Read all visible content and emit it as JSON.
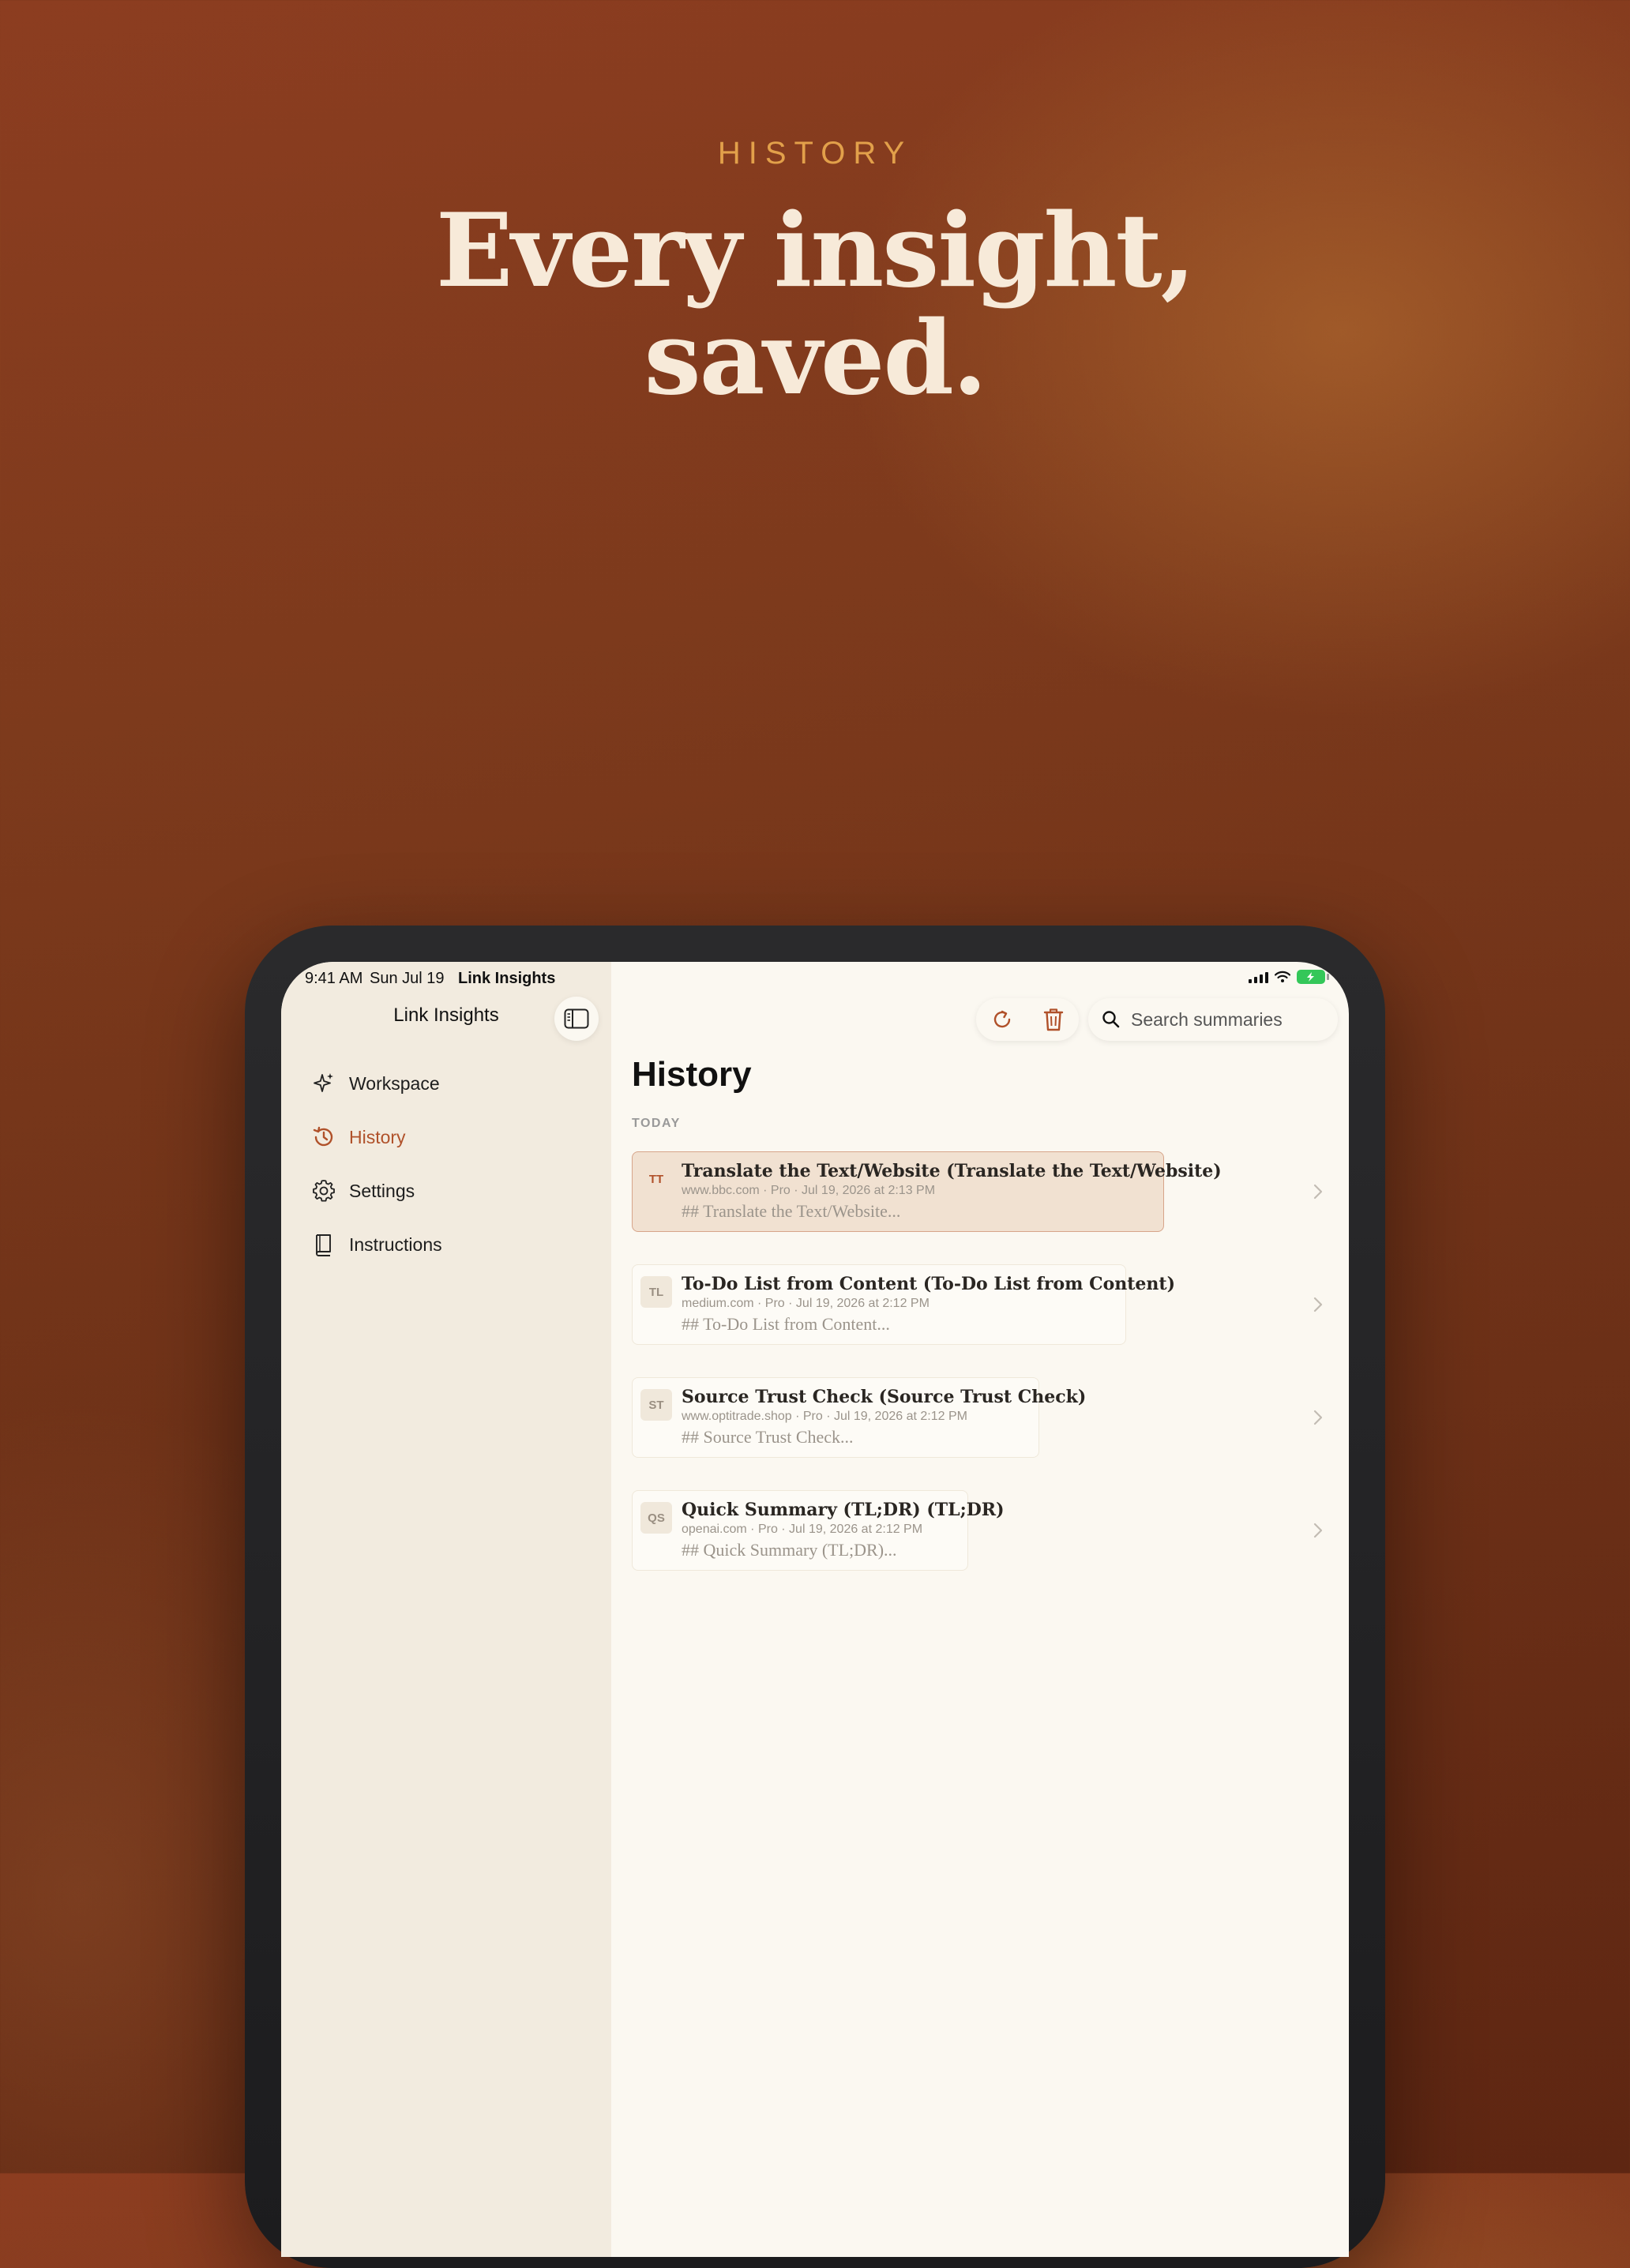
{
  "hero": {
    "kicker": "HISTORY",
    "headline_line1": "Every insight,",
    "headline_line2": "saved."
  },
  "status_bar": {
    "time": "9:41 AM",
    "date": "Sun Jul 19",
    "app_name": "Link Insights"
  },
  "sidebar": {
    "title": "Link Insights",
    "items": [
      {
        "label": "Workspace",
        "icon": "sparkles-icon"
      },
      {
        "label": "History",
        "icon": "history-icon",
        "active": true
      },
      {
        "label": "Settings",
        "icon": "gear-icon"
      },
      {
        "label": "Instructions",
        "icon": "book-icon"
      }
    ]
  },
  "toolbar": {
    "search_placeholder": "Search summaries"
  },
  "main": {
    "title": "History",
    "section": "TODAY",
    "entries": [
      {
        "initials": "TT",
        "title": "Translate the Text/Website (Translate the Text/Website)",
        "meta": "www.bbc.com · Pro · Jul 19, 2026 at 2:13 PM",
        "preview": "## Translate the Text/Website...",
        "selected": true
      },
      {
        "initials": "TL",
        "title": "To-Do List from Content (To-Do List from Content)",
        "meta": "medium.com · Pro · Jul 19, 2026 at 2:12 PM",
        "preview": "## To-Do List from Content..."
      },
      {
        "initials": "ST",
        "title": "Source Trust Check (Source Trust Check)",
        "meta": "www.optitrade.shop · Pro · Jul 19, 2026 at 2:12 PM",
        "preview": "## Source Trust Check..."
      },
      {
        "initials": "QS",
        "title": "Quick Summary (TL;DR) (TL;DR)",
        "meta": "openai.com · Pro · Jul 19, 2026 at 2:12 PM",
        "preview": "## Quick Summary (TL;DR)..."
      }
    ]
  },
  "colors": {
    "accent": "#b0512a",
    "kicker": "#e2a04a",
    "headline": "#f7ead9",
    "sidebar_bg": "#f2ebdf",
    "main_bg": "#fbf8f1",
    "selected_row": "#f1e1d1"
  }
}
